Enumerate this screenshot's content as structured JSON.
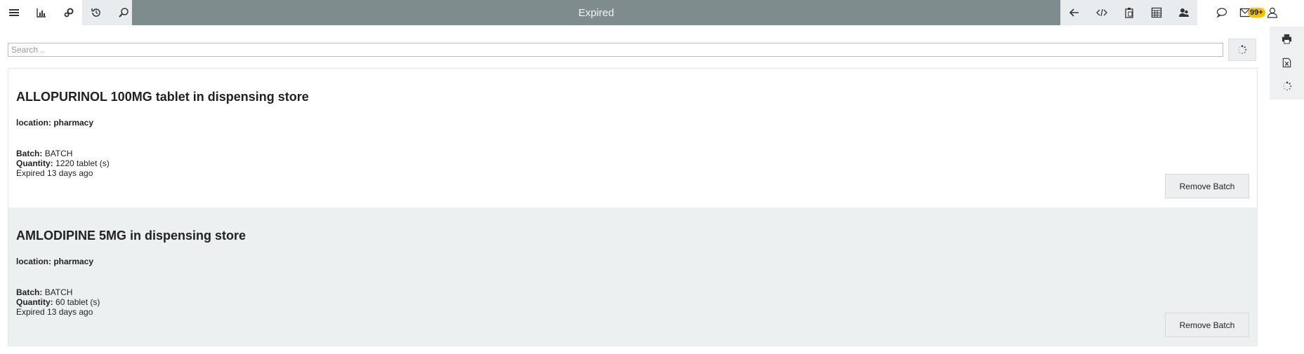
{
  "header": {
    "title": "Expired",
    "notifications_badge": "99+",
    "left_icons": [
      "menu-icon",
      "bar-chart-icon",
      "cogs-icon",
      "history-icon",
      "search-icon"
    ],
    "mid_icons": [
      "arrow-left-icon",
      "code-icon",
      "clipboard-icon",
      "calculator-icon",
      "users-icon"
    ],
    "right_icons": [
      "comment-icon",
      "envelope-icon",
      "user-icon"
    ]
  },
  "search": {
    "placeholder": "Search .."
  },
  "rail": {
    "icons": [
      "print-icon",
      "excel-icon",
      "spinner-icon"
    ]
  },
  "items": [
    {
      "title": "ALLOPURINOL 100MG tablet in dispensing store",
      "location": "location: pharmacy",
      "batch_label": "Batch:",
      "batch": "BATCH",
      "quantity_label": "Quantity:",
      "quantity": "1220 tablet (s)",
      "expiry": "Expired 13 days ago",
      "action": "Remove Batch"
    },
    {
      "title": "AMLODIPINE 5MG in dispensing store",
      "location": "location: pharmacy",
      "batch_label": "Batch:",
      "batch": "BATCH",
      "quantity_label": "Quantity:",
      "quantity": "60 tablet (s)",
      "expiry": "Expired 13 days ago",
      "action": "Remove Batch"
    }
  ]
}
